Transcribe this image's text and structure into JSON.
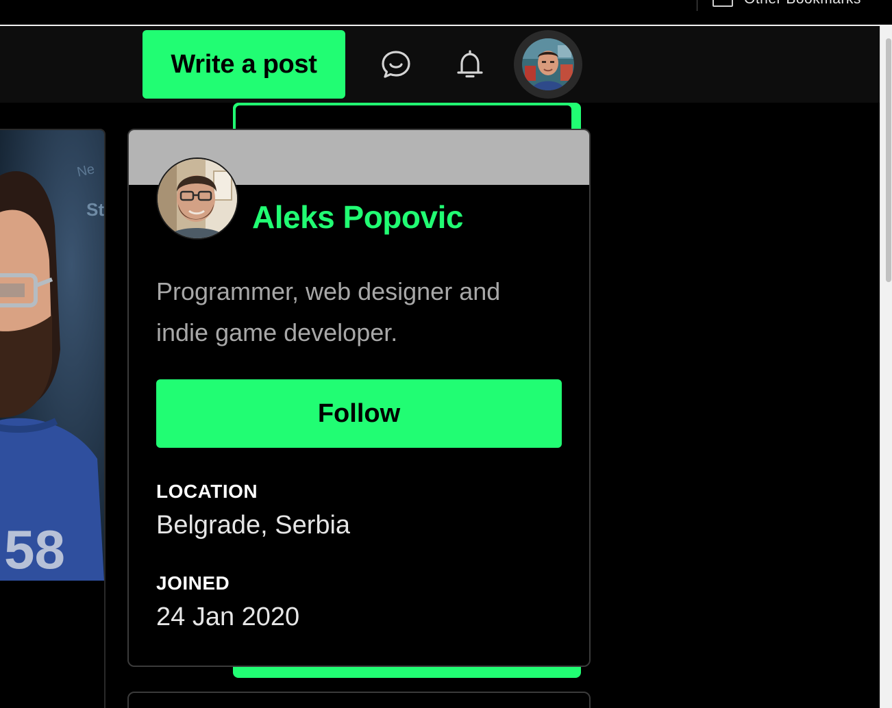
{
  "browser": {
    "bookmarks_label": "Other Bookmarks"
  },
  "header": {
    "write_post_label": "Write a post",
    "icons": [
      "chat-icon",
      "bell-icon"
    ]
  },
  "profile_card": {
    "name": "Aleks Popovic",
    "bio": "Programmer, web designer and indie game developer.",
    "follow_label": "Follow",
    "location_label": "LOCATION",
    "location_value": "Belgrade, Serbia",
    "joined_label": "JOINED",
    "joined_value": "24 Jan 2020"
  },
  "colors": {
    "accent": "#21fd73",
    "background": "#000000",
    "banner": "#b4b4b4",
    "bio_text": "#a8a8a8"
  }
}
